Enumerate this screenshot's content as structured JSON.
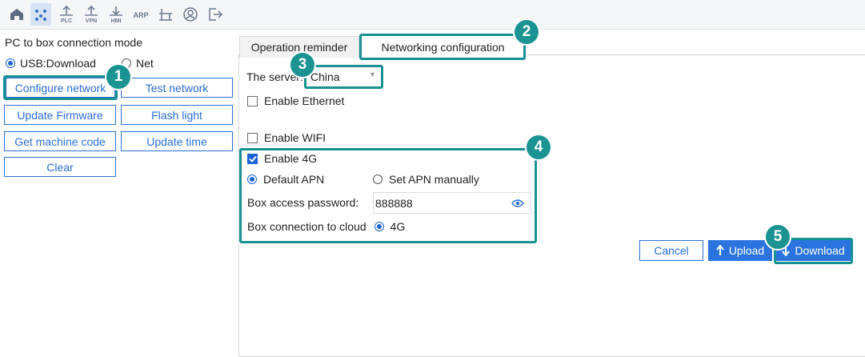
{
  "toolbar": {
    "icons": [
      "home-icon",
      "device-icon",
      "plc-icon",
      "vpn-icon",
      "hmi-icon",
      "arp-icon",
      "network-icon",
      "user-icon",
      "logout-icon"
    ],
    "plc_label": "PLC",
    "vpn_label": "VPN",
    "hmi_label": "HMI",
    "arp_label": "ARP"
  },
  "left": {
    "title": "PC to box connection mode",
    "mode_usb": "USB:Download",
    "mode_net": "Net",
    "selected_mode": "USB:Download",
    "buttons": {
      "configure_network": "Configure network",
      "test_network": "Test network",
      "update_firmware": "Update Firmware",
      "flash_light": "Flash light",
      "get_machine_code": "Get machine code",
      "update_time": "Update time",
      "clear": "Clear"
    }
  },
  "tabs": {
    "operation_reminder": "Operation reminder",
    "networking_configuration": "Networking configuration",
    "active": "Networking configuration"
  },
  "form": {
    "server_label": "The server:",
    "server_value": "China",
    "enable_ethernet": "Enable Ethernet",
    "enable_ethernet_checked": false,
    "enable_wifi": "Enable WIFI",
    "enable_wifi_checked": false,
    "enable_4g": "Enable 4G",
    "enable_4g_checked": true,
    "default_apn": "Default APN",
    "set_apn_manually": "Set APN manually",
    "apn_selected": "Default APN",
    "password_label": "Box access password:",
    "password_value": "888888",
    "cloud_label": "Box connection to cloud",
    "cloud_option": "4G"
  },
  "actions": {
    "cancel": "Cancel",
    "upload": "Upload",
    "download": "Download"
  },
  "callouts": [
    "1",
    "2",
    "3",
    "4",
    "5"
  ],
  "colors": {
    "accent": "#2b6fd6",
    "primary_button": "#2b74e0",
    "highlight": "#179191",
    "badge": "#1b9393"
  }
}
